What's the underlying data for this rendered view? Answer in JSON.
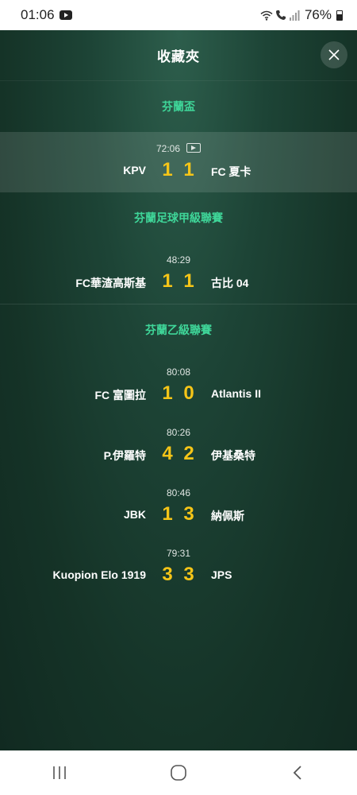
{
  "status": {
    "time": "01:06",
    "battery": "76%"
  },
  "header": {
    "title": "收藏夾"
  },
  "leagues": [
    {
      "name": "芬蘭盃",
      "matches": [
        {
          "time": "72:06",
          "home": "KPV",
          "home_score": "1",
          "away_score": "1",
          "away": "FC 夏卡",
          "video": true
        }
      ]
    },
    {
      "name": "芬蘭足球甲級聯賽",
      "matches": [
        {
          "time": "48:29",
          "home": "FC華渣高斯基",
          "home_score": "1",
          "away_score": "1",
          "away": "古比 04"
        }
      ]
    },
    {
      "name": "芬蘭乙級聯賽",
      "matches": [
        {
          "time": "80:08",
          "home": "FC 富圖拉",
          "home_score": "1",
          "away_score": "0",
          "away": "Atlantis II"
        },
        {
          "time": "80:26",
          "home": "P.伊羅特",
          "home_score": "4",
          "away_score": "2",
          "away": "伊基桑特"
        },
        {
          "time": "80:46",
          "home": "JBK",
          "home_score": "1",
          "away_score": "3",
          "away": "納佩斯"
        },
        {
          "time": "79:31",
          "home": "Kuopion Elo 1919",
          "home_score": "3",
          "away_score": "3",
          "away": "JPS"
        }
      ]
    }
  ],
  "colors": {
    "league": "#3fd699",
    "score": "#f5c518",
    "panel": "#1d4436"
  },
  "icons": [
    "youtube-icon",
    "wifi-icon",
    "call-icon",
    "signal-icon",
    "battery-icon",
    "close-icon",
    "video-icon",
    "recents-icon",
    "home-icon",
    "back-icon"
  ]
}
